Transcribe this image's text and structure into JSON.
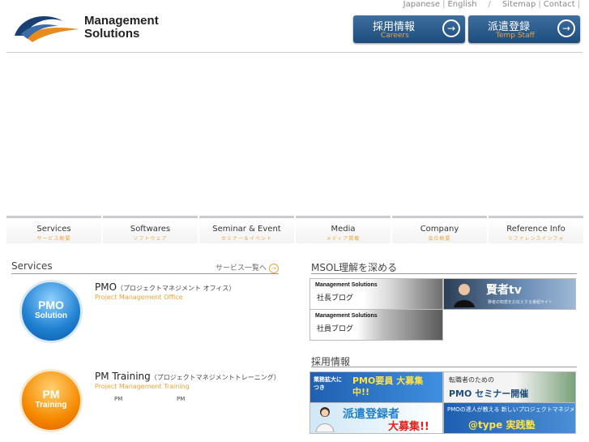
{
  "header": {
    "logo_line1": "Management",
    "logo_line2": "Solutions",
    "links": [
      "Japanese",
      "English",
      "Sitemap",
      "Contact"
    ],
    "buttons": [
      {
        "jp": "採用情報",
        "en": "Careers"
      },
      {
        "jp": "派遣登録",
        "en": "Temp Staff"
      }
    ]
  },
  "nav": [
    {
      "en": "Services",
      "jp": "サービス概要"
    },
    {
      "en": "Softwares",
      "jp": "ソフトウェア"
    },
    {
      "en": "Seminar & Event",
      "jp": "セミナー＆イベント"
    },
    {
      "en": "Media",
      "jp": "メディア掲載"
    },
    {
      "en": "Company",
      "jp": "会社概要"
    },
    {
      "en": "Reference Info",
      "jp": "リファレンスインフォ"
    }
  ],
  "services": {
    "title": "Services",
    "more_link": "サービス一覧へ",
    "items": [
      {
        "ball_a": "PMO",
        "ball_b": "Solution",
        "name": "PMO",
        "name_jp": "（プロジェクトマネジメント オフィス）",
        "sub": "Project Management Office",
        "tiny": []
      },
      {
        "ball_a": "PM",
        "ball_b": "Training",
        "name": "PM Training",
        "name_jp": "（プロジェクトマネジメントトレーニング）",
        "sub": "Project Management Training",
        "tiny": [
          "PM",
          "PM"
        ]
      }
    ]
  },
  "right": {
    "deepen_title": "MSOL理解を深める",
    "banners1": [
      {
        "line1": "Management Solutions",
        "line2": "社長ブログ"
      },
      {
        "line1": "賢者tv",
        "line2": "賢者の知恵をお伝えする番組サイト"
      },
      {
        "line1": "Management Solutions",
        "line2": "社員ブログ"
      }
    ],
    "recruit_title": "採用情報",
    "banners2": [
      {
        "line1": "業務拡大につき",
        "line2": "PMO要員 大募集中!!"
      },
      {
        "line1": "転職者のための",
        "line2": "PMO セミナー開催"
      },
      {
        "line1": "派遣登録者",
        "line2": "大募集!!"
      },
      {
        "line1": "PMOの達人が教える 新しいプロジェクトマネジメント",
        "line2": "@type 実践塾"
      }
    ]
  },
  "colors": {
    "navy": "#1d4c7c",
    "accent_orange": "#f0a43c"
  }
}
